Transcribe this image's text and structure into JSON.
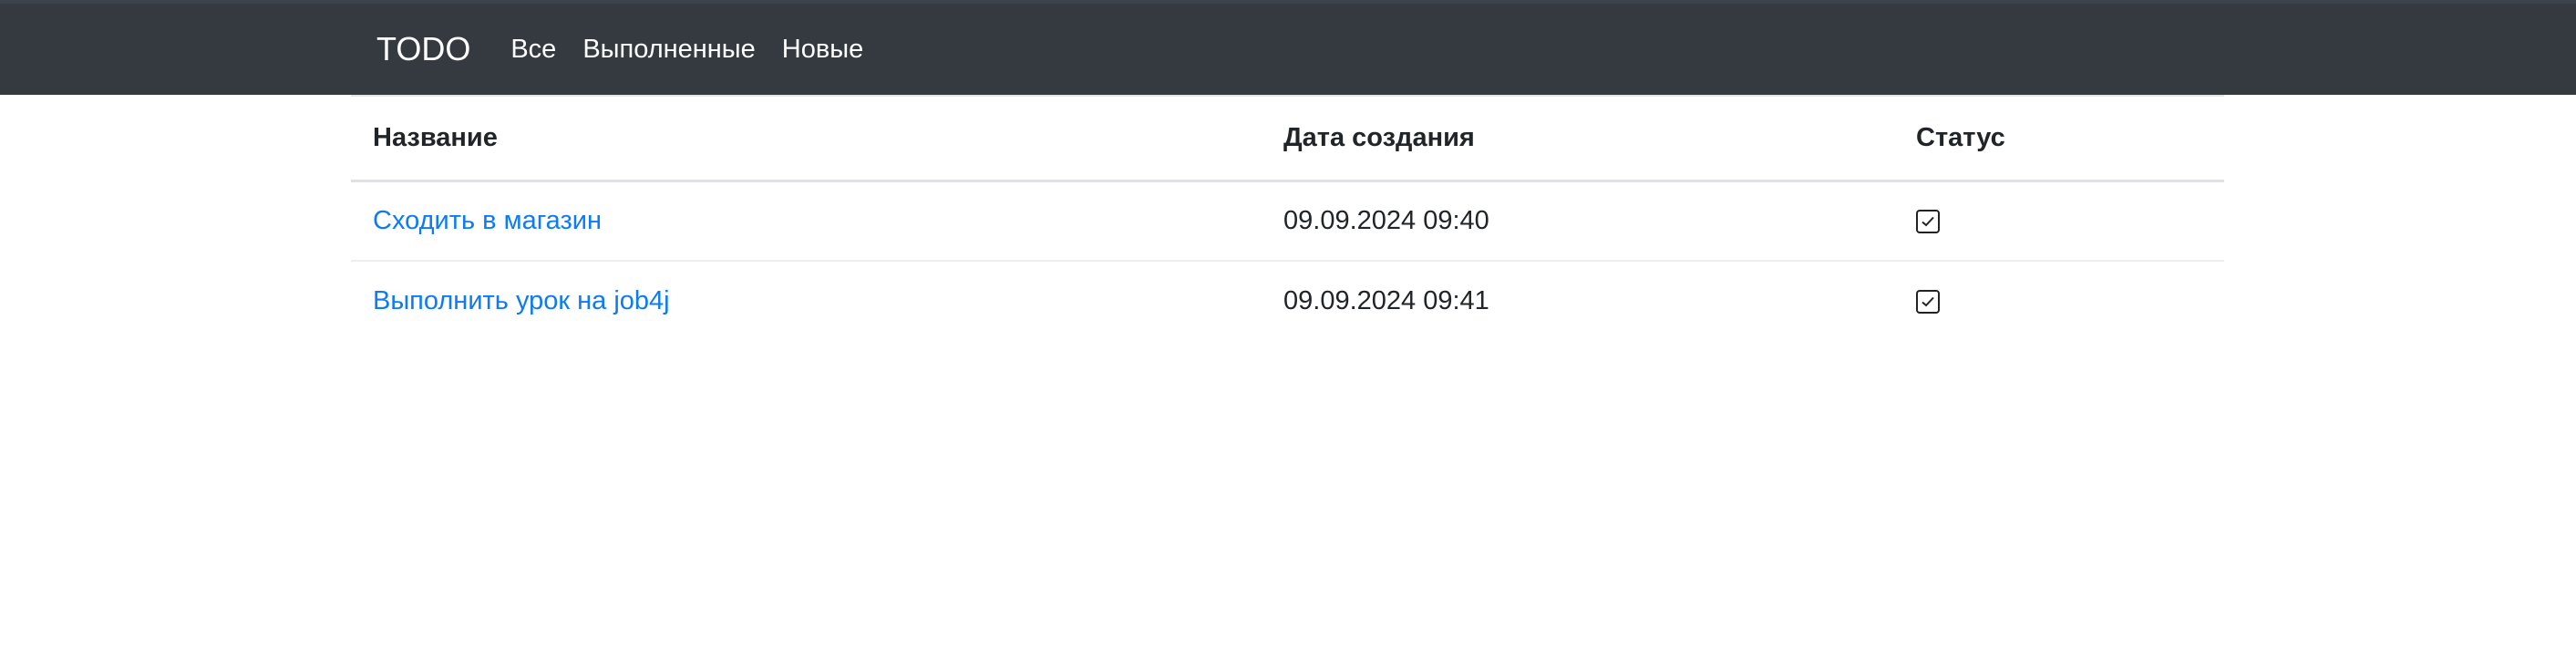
{
  "navbar": {
    "brand": "TODO",
    "links": [
      "Все",
      "Выполненные",
      "Новые"
    ]
  },
  "table": {
    "headers": [
      "Название",
      "Дата создания",
      "Статус"
    ],
    "rows": [
      {
        "title": "Сходить в магазин",
        "created": "09.09.2024 09:40",
        "done": true
      },
      {
        "title": "Выполнить урок на job4j",
        "created": "09.09.2024 09:41",
        "done": true
      }
    ]
  },
  "colors": {
    "navbar_bg": "#343a40",
    "link": "#0d7bf4"
  },
  "icons": {
    "status_done": "checkbox-checked-icon"
  }
}
